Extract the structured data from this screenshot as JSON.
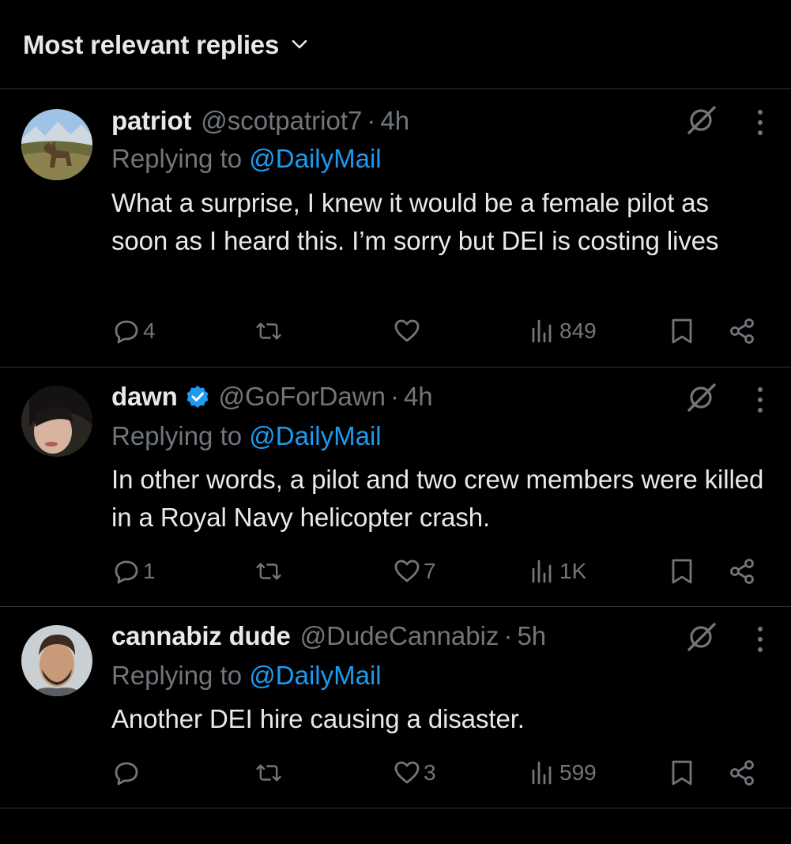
{
  "header": {
    "sort_label": "Most relevant replies"
  },
  "replies": [
    {
      "name": "patriot",
      "verified": false,
      "handle": "@scotpatriot7",
      "time": "4h",
      "replying_prefix": "Replying to ",
      "replying_to": "@DailyMail",
      "text": "What a surprise, I knew it would be a female pilot as soon as I heard this. I’m sorry but DEI is costing lives",
      "reply_count": "4",
      "retweet_count": "",
      "like_count": "",
      "view_count": "849"
    },
    {
      "name": "dawn",
      "verified": true,
      "handle": "@GoForDawn",
      "time": "4h",
      "replying_prefix": "Replying to ",
      "replying_to": "@DailyMail",
      "text": "In other words, a pilot and two crew members were killed in a Royal Navy helicopter crash.",
      "reply_count": "1",
      "retweet_count": "",
      "like_count": "7",
      "view_count": "1K"
    },
    {
      "name": "cannabiz dude",
      "verified": false,
      "handle": "@DudeCannabiz",
      "time": "5h",
      "replying_prefix": "Replying to ",
      "replying_to": "@DailyMail",
      "text": "Another DEI hire causing a disaster.",
      "reply_count": "",
      "retweet_count": "",
      "like_count": "3",
      "view_count": "599"
    }
  ],
  "colors": {
    "background": "#000000",
    "text": "#e7e9ea",
    "muted": "#71767b",
    "link": "#1d9bf0",
    "divider": "#2f3336",
    "verified": "#1d9bf0"
  },
  "icons": {
    "sort": "chevron-down-icon",
    "grok": "grok-icon",
    "more": "more-vertical-icon",
    "reply": "reply-icon",
    "retweet": "retweet-icon",
    "like": "heart-icon",
    "views": "views-icon",
    "bookmark": "bookmark-icon",
    "share": "share-icon",
    "verified": "verified-badge-icon"
  }
}
